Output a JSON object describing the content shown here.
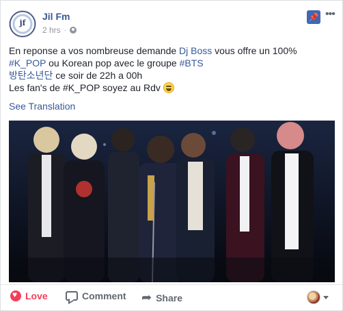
{
  "post": {
    "page_name": "Jil Fm",
    "avatar_monogram": "jf",
    "time": "2 hrs",
    "separator": "·",
    "privacy_icon": "globe-icon",
    "text_line1_part1": "En reponse a vos nombreuse demande ",
    "text_line1_link": "Dj Boss",
    "text_line1_part2": " vous offre un 100%",
    "text_line2_hashtag1": "#K_POP",
    "text_line2_mid": " ou Korean pop avec le groupe ",
    "text_line2_hashtag2": "#BTS",
    "text_line3_link": "방탄소년단",
    "text_line3_rest": " ce soir de 22h a 00h",
    "text_line4": "Les fan's de #K_POP soyez au Rdv ",
    "emoji_name": "grinning-face-emoji",
    "see_translation": "See Translation"
  },
  "header_actions": {
    "pin_icon": "pin-icon",
    "more_icon": "more-options-icon"
  },
  "actions": {
    "love_label": "Love",
    "comment_label": "Comment",
    "share_label": "Share"
  },
  "colors": {
    "link": "#365899",
    "love": "#f33e58",
    "pin_button": "#4267b2",
    "muted": "#90949c"
  }
}
